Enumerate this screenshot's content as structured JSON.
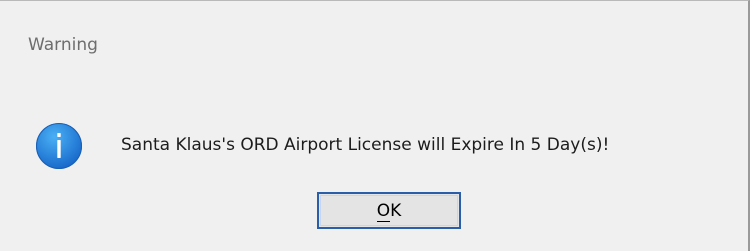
{
  "dialog": {
    "title": "Warning",
    "icon": "info-icon",
    "message": "Santa Klaus's ORD Airport License will Expire In 5 Day(s)!",
    "ok_button": {
      "label": "OK",
      "mnemonic": "O"
    }
  },
  "colors": {
    "dialog_background": "#f0f0f0",
    "icon_blue": "#1a7fd6",
    "button_border": "#2a5ea9",
    "button_face": "#e4e4e4"
  }
}
